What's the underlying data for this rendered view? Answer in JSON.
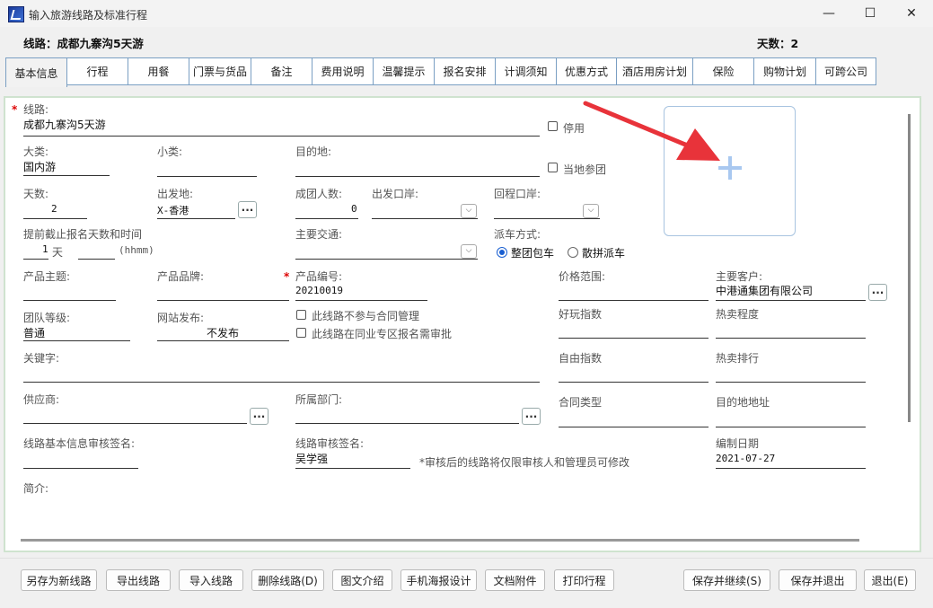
{
  "window": {
    "title": "输入旅游线路及标准行程",
    "minimize": "—",
    "maximize": "☐",
    "close": "✕"
  },
  "header": {
    "route_label": "线路：",
    "route_value": "成都九寨沟5天游",
    "days_label": "天数：",
    "days_value": "2"
  },
  "tabs": [
    {
      "label": "基本信息",
      "active": true
    },
    {
      "label": "行程"
    },
    {
      "label": "用餐"
    },
    {
      "label": "门票与货品"
    },
    {
      "label": "备注"
    },
    {
      "label": "费用说明"
    },
    {
      "label": "温馨提示"
    },
    {
      "label": "报名安排"
    },
    {
      "label": "计调须知"
    },
    {
      "label": "优惠方式"
    },
    {
      "label": "酒店用房计划"
    },
    {
      "label": "保险"
    },
    {
      "label": "购物计划"
    },
    {
      "label": "可跨公司"
    }
  ],
  "form": {
    "route": {
      "label": "线路:",
      "value": "成都九寨沟5天游"
    },
    "disabled": {
      "label": "停用"
    },
    "category": {
      "label": "大类:",
      "value": "国内游"
    },
    "subcategory": {
      "label": "小类:",
      "value": ""
    },
    "destination": {
      "label": "目的地:",
      "value": ""
    },
    "local_join": {
      "label": "当地参团"
    },
    "days": {
      "label": "天数:",
      "value": "2"
    },
    "departure": {
      "label": "出发地:",
      "value": "X-香港",
      "btn": "..."
    },
    "group_size": {
      "label": "成团人数:",
      "value": "0"
    },
    "departure_port": {
      "label": "出发口岸:",
      "value": ""
    },
    "return_port": {
      "label": "回程口岸:",
      "value": ""
    },
    "deadline": {
      "label": "提前截止报名天数和时间",
      "days_value": "1",
      "days_unit": "天",
      "time_unit": "(hhmm)"
    },
    "main_transport": {
      "label": "主要交通:",
      "value": ""
    },
    "vehicle_mode": {
      "label": "派车方式:",
      "option1": "整团包车",
      "option2": "散拼派车",
      "selected": "option1"
    },
    "product_theme": {
      "label": "产品主题:",
      "value": ""
    },
    "product_brand": {
      "label": "产品品牌:",
      "value": ""
    },
    "product_code": {
      "label": "产品编号:",
      "value": "20210019"
    },
    "price_range": {
      "label": "价格范围:",
      "value": ""
    },
    "main_customer": {
      "label": "主要客户:",
      "value": "中港通集团有限公司",
      "btn": "..."
    },
    "group_level": {
      "label": "团队等级:",
      "value": "普通"
    },
    "web_publish": {
      "label": "网站发布:",
      "value": "不发布"
    },
    "no_contract": {
      "label": "此线路不参与合同管理"
    },
    "need_approval": {
      "label": "此线路在同业专区报名需审批"
    },
    "fun_index": {
      "label": "好玩指数"
    },
    "hot_level": {
      "label": "热卖程度"
    },
    "keywords": {
      "label": "关键字:",
      "value": ""
    },
    "free_index": {
      "label": "自由指数"
    },
    "hot_rank": {
      "label": "热卖排行"
    },
    "supplier": {
      "label": "供应商:",
      "value": "",
      "btn": "..."
    },
    "department": {
      "label": "所属部门:",
      "value": "",
      "btn": "..."
    },
    "contract_type": {
      "label": "合同类型"
    },
    "dest_address": {
      "label": "目的地地址"
    },
    "basic_audit_sign": {
      "label": "线路基本信息审核签名:",
      "value": ""
    },
    "route_audit_sign": {
      "label": "线路审核签名:",
      "value": "吴学强"
    },
    "audit_note": "*审核后的线路将仅限审核人和管理员可修改",
    "compile_date": {
      "label": "编制日期",
      "value": "2021-07-27"
    },
    "intro": {
      "label": "简介:"
    }
  },
  "buttons": [
    "另存为新线路",
    "导出线路",
    "导入线路",
    "删除线路(D)",
    "图文介绍",
    "手机海报设计",
    "文档附件",
    "打印行程",
    "保存并继续(S)",
    "保存并退出",
    "退出(E)"
  ],
  "colors": {
    "accent": "#1a5fd1",
    "arrow": "#e8333a",
    "required": "#dd0000"
  },
  "icons": {
    "upload": "plus-icon",
    "arrow": "red-arrow-icon"
  }
}
